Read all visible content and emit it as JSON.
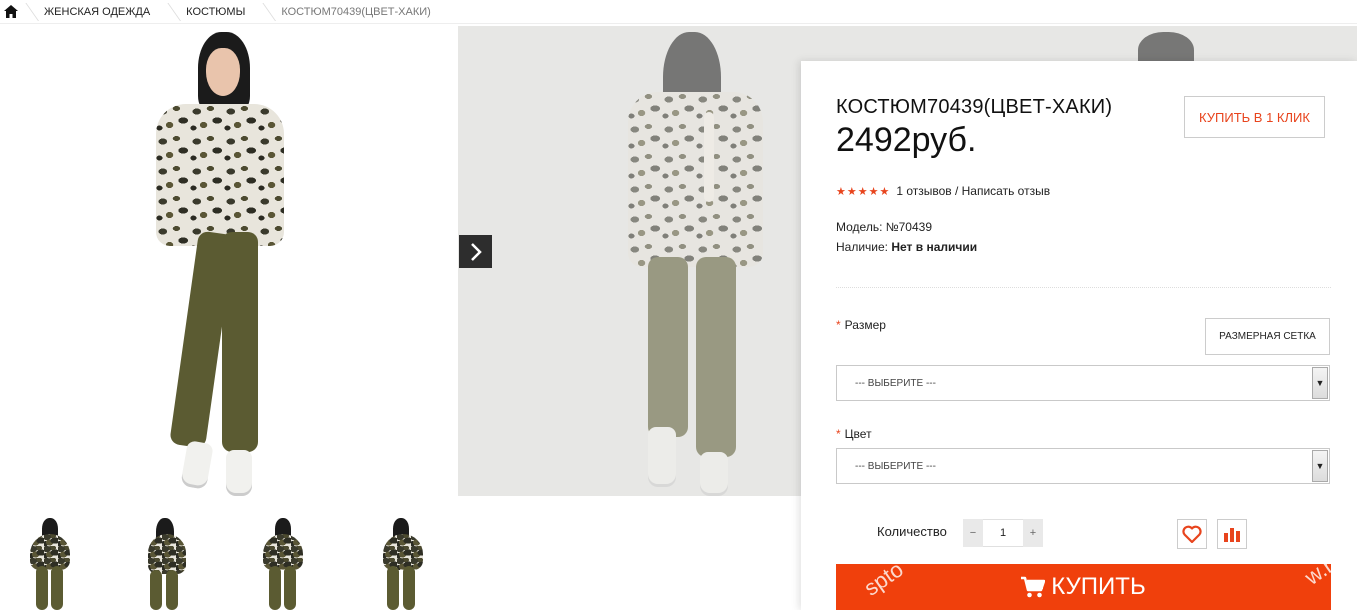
{
  "breadcrumb": {
    "home_icon": "home-icon",
    "items": [
      "ЖЕНСКАЯ ОДЕЖДА",
      "КОСТЮМЫ",
      "КОСТЮМ70439(ЦВЕТ-ХАКИ)"
    ]
  },
  "gallery": {
    "next_icon": "chevron-right-icon",
    "thumbnail_count": 4
  },
  "product": {
    "title": "КОСТЮМ70439(ЦВЕТ-ХАКИ)",
    "price": "2492руб.",
    "one_click_label": "КУПИТЬ В 1 КЛИК",
    "stars": "★★★★★",
    "rating_value": 5,
    "reviews_text": "1 отзывов / Написать отзыв",
    "model_label": "Модель:",
    "model_value": "№70439",
    "availability_label": "Наличие:",
    "availability_value": "Нет в наличии"
  },
  "options": {
    "size_label": "Размер",
    "size_chart_label": "РАЗМЕРНАЯ СЕТКА",
    "size_select_value": "--- ВЫБЕРИТЕ ---",
    "color_label": "Цвет",
    "color_select_value": "--- ВЫБЕРИТЕ ---"
  },
  "purchase": {
    "quantity_label": "Количество",
    "quantity_value": "1",
    "minus": "−",
    "plus": "+",
    "wishlist_icon": "heart-icon",
    "compare_icon": "bar-chart-icon",
    "buy_label": "КУПИТЬ",
    "buy_icon": "cart-icon"
  },
  "watermark": {
    "left_text": "spto",
    "right_text": "w.r"
  },
  "colors": {
    "accent": "#f0400c",
    "accent_text": "#e8441d"
  }
}
